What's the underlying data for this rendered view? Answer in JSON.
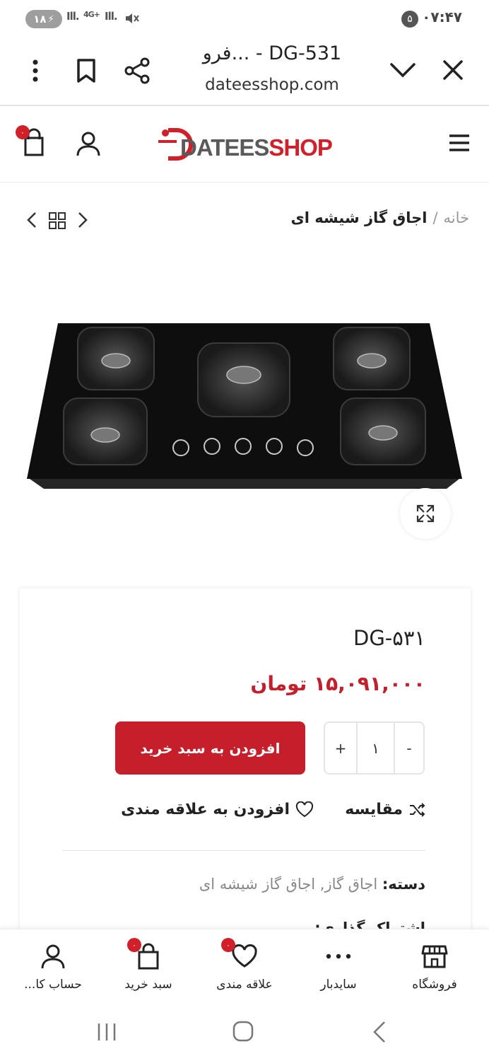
{
  "status_bar": {
    "battery": "۱۸",
    "signal_1": "Ill.",
    "network": "4G+",
    "signal_2": "Ill.",
    "notification_count": "۵",
    "time": "۰۷:۴۷"
  },
  "browser": {
    "title": "فرو... - DG-531",
    "url": "dateesshop.com"
  },
  "header": {
    "logo_dark": "DATEES",
    "logo_red": "SHOP",
    "cart_count": "۰"
  },
  "breadcrumb": {
    "home": "خانه",
    "separator": "/",
    "current": "اجاق گاز شیشه ای"
  },
  "product": {
    "title": "DG-۵۳۱",
    "price": "۱۵,۰۹۱,۰۰۰ تومان",
    "add_to_cart": "افزودن به سبد خرید",
    "qty_plus": "+",
    "qty_value": "۱",
    "qty_minus": "-",
    "compare": "مقایسه",
    "wishlist": "افزودن به علاقه مندی",
    "category_label": "دسته:",
    "category_value": "اجاق گاز, اجاق گاز شیشه ای",
    "share_label": "اشتراک گذاری:"
  },
  "bottom_nav": {
    "shop": "فروشگاه",
    "sidebar": "سایدبار",
    "wishlist": "علاقه مندی",
    "wishlist_count": "۰",
    "cart": "سبد خرید",
    "cart_count": "۰",
    "account": "حساب کا..."
  },
  "colors": {
    "brand_red": "#c41f2b",
    "price_red": "#c0212c"
  },
  "icons": [
    "battery-icon",
    "mute-icon",
    "close-icon",
    "chevron-down-icon",
    "share-icon",
    "bookmark-icon",
    "more-vert-icon",
    "menu-icon",
    "user-icon",
    "cart-icon",
    "grid-icon",
    "chevron-left-icon",
    "chevron-right-icon",
    "expand-icon",
    "shuffle-icon",
    "heart-icon",
    "store-icon",
    "dots-icon",
    "recent-apps-icon",
    "home-icon",
    "back-icon"
  ]
}
